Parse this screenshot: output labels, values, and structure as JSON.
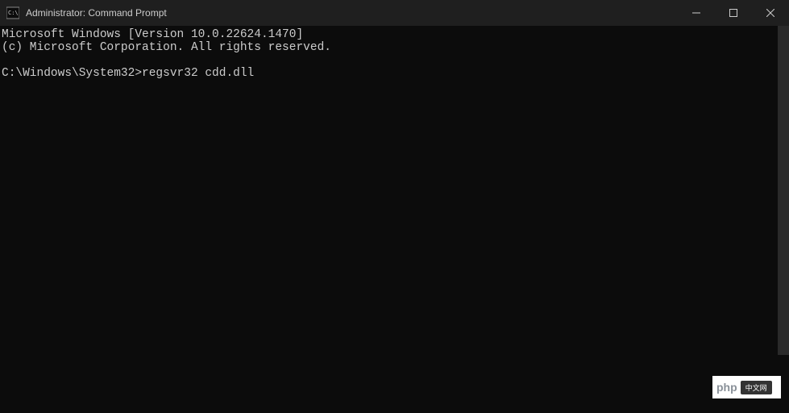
{
  "window": {
    "title": "Administrator: Command Prompt"
  },
  "terminal": {
    "line1": "Microsoft Windows [Version 10.0.22624.1470]",
    "line2": "(c) Microsoft Corporation. All rights reserved.",
    "line3": "",
    "prompt": "C:\\Windows\\System32>",
    "command": "regsvr32 cdd.dll"
  },
  "watermark": {
    "text": "php",
    "badge": "中文网"
  }
}
